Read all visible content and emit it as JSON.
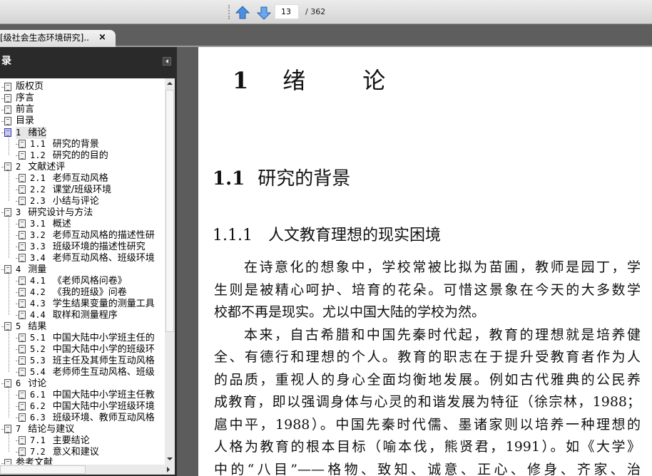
{
  "toolbar": {
    "page_current": "13",
    "page_total": "/ 362"
  },
  "tab": {
    "title": "[级社会生态环境研究]....",
    "close": "×"
  },
  "sidebar": {
    "title": "录",
    "items": [
      {
        "num": "",
        "label": "版权页",
        "level": 0
      },
      {
        "num": "",
        "label": "序言",
        "level": 0
      },
      {
        "num": "",
        "label": "前言",
        "level": 0
      },
      {
        "num": "",
        "label": "目录",
        "level": 0
      },
      {
        "num": "1",
        "label": "绪论",
        "level": 0,
        "selected": true
      },
      {
        "num": "1.1",
        "label": "研究的背景",
        "level": 1
      },
      {
        "num": "1.2",
        "label": "研究的的目的",
        "level": 1
      },
      {
        "num": "2",
        "label": "文献述评",
        "level": 0
      },
      {
        "num": "2.1",
        "label": "老师互动风格",
        "level": 1
      },
      {
        "num": "2.2",
        "label": "课堂/班级环境",
        "level": 1
      },
      {
        "num": "2.3",
        "label": "小结与评论",
        "level": 1
      },
      {
        "num": "3",
        "label": "研究设计与方法",
        "level": 0
      },
      {
        "num": "3.1",
        "label": "概述",
        "level": 1
      },
      {
        "num": "3.2",
        "label": "老师互动风格的描述性研",
        "level": 1
      },
      {
        "num": "3.3",
        "label": "班级环境的描述性研究",
        "level": 1
      },
      {
        "num": "3.4",
        "label": "老师互动风格、班级环境",
        "level": 1
      },
      {
        "num": "4",
        "label": "测量",
        "level": 0
      },
      {
        "num": "4.1",
        "label": "《老师风格问卷》",
        "level": 1
      },
      {
        "num": "4.2",
        "label": "《我的班级》问卷",
        "level": 1
      },
      {
        "num": "4.3",
        "label": "学生结果变量的测量工具",
        "level": 1
      },
      {
        "num": "4.4",
        "label": "取样和测量程序",
        "level": 1
      },
      {
        "num": "5",
        "label": "结果",
        "level": 0
      },
      {
        "num": "5.1",
        "label": "中国大陆中小学班主任的",
        "level": 1
      },
      {
        "num": "5.2",
        "label": "中国大陆中小学的班级环",
        "level": 1
      },
      {
        "num": "5.3",
        "label": "班主任及其师生互动风格",
        "level": 1
      },
      {
        "num": "5.4",
        "label": "老师师生互动风格、班级",
        "level": 1
      },
      {
        "num": "6",
        "label": "讨论",
        "level": 0
      },
      {
        "num": "6.1",
        "label": "中国大陆中小学班主任教",
        "level": 1
      },
      {
        "num": "6.2",
        "label": "中国大陆中小学班级环境",
        "level": 1
      },
      {
        "num": "6.3",
        "label": "班级环境、教师互动风格",
        "level": 1
      },
      {
        "num": "7",
        "label": "结论与建议",
        "level": 0
      },
      {
        "num": "7.1",
        "label": "主要结论",
        "level": 1
      },
      {
        "num": "7.2",
        "label": "意义和建议",
        "level": 1
      },
      {
        "num": "",
        "label": "参考文献",
        "level": 0
      }
    ]
  },
  "document": {
    "chapter_num": "1",
    "chapter_title": "绪论",
    "section_num": "1.1",
    "section_title": "研究的背景",
    "subsection_num": "1.1.1",
    "subsection_title": "人文教育理想的现实困境",
    "lines": [
      {
        "t": "在诗意化的想象中，学校常被比拟为苗圃，教师是园丁，学",
        "first": true
      },
      {
        "t": "生则是被精心呵护、培育的花朵。可惜这景象在今天的大多数学"
      },
      {
        "t": "校都不再是现实。尤以中国大陆的学校为然。",
        "last": true
      },
      {
        "t": "本来，自古希腊和中国先秦时代起，教育的理想就是培养健",
        "first": true
      },
      {
        "t": "全、有德行和理想的个人。教育的职志在于提升受教育者作为人"
      },
      {
        "t": "的品质，重视人的身心全面均衡地发展。例如古代雅典的公民养"
      },
      {
        "t": "成教育，即以强调身体与心灵的和谐发展为特征（徐宗林，1988；"
      },
      {
        "t": "扈中平，1988）。中国先秦时代儒、墨诸家则以培养一种理想的"
      },
      {
        "t": "人格为教育的根本目标（喻本伐，熊贤君，1991）。如《大学》"
      },
      {
        "t": "中的“八目”——格物、致知、诚意、正心、修身、齐家、治"
      }
    ]
  }
}
